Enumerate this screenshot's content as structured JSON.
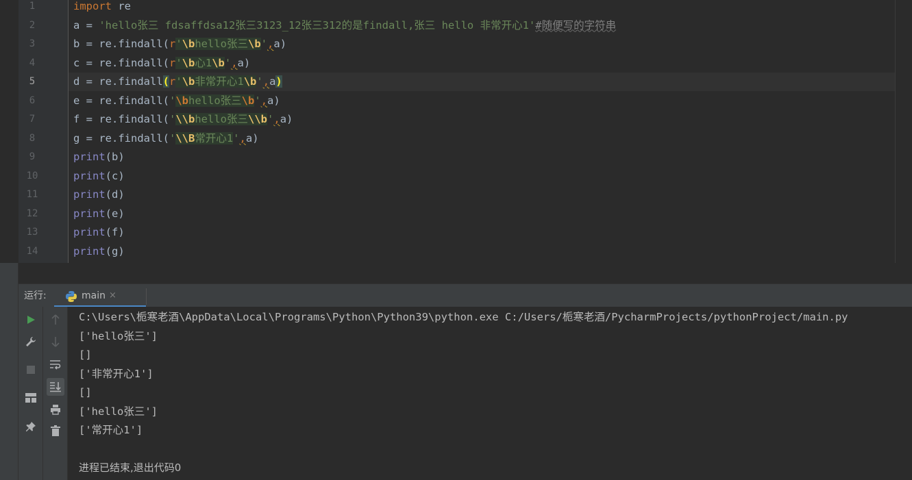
{
  "editor": {
    "line_numbers": [
      "1",
      "2",
      "3",
      "4",
      "5",
      "6",
      "7",
      "8",
      "9",
      "10",
      "11",
      "12",
      "13",
      "14"
    ],
    "current_line": "5",
    "lines": {
      "l1": {
        "kw": "import",
        "rest": " re"
      },
      "l2": {
        "lhs": "a = ",
        "str": "'hello张三 fdsaffdsa12张三3123_12张三312的是findall,张三 hello 非常开心1'",
        "comment": "#随便写的字符串"
      },
      "l3": {
        "lhs": "b = re.findall(",
        "r": "r",
        "q1": "'",
        "esc1": "\\b",
        "body": "hello张三",
        "esc2": "\\b",
        "q2": "'",
        "comma": ",",
        "arg": "a)"
      },
      "l4": {
        "lhs": "c = re.findall(",
        "r": "r",
        "q1": "'",
        "esc1": "\\b",
        "body": "心1",
        "esc2": "\\b",
        "q2": "'",
        "comma": ",",
        "arg": "a)"
      },
      "l5": {
        "lhs": "d = re.findall",
        "open": "(",
        "r": "r",
        "q1": "'",
        "esc1": "\\b",
        "body": "非常开心1",
        "esc2": "\\b",
        "q2": "'",
        "comma": ",",
        "arg": "a",
        "close": ")"
      },
      "l6": {
        "lhs": "e = re.findall(",
        "q1": "'",
        "esc1": "\\b",
        "body": "hello张三",
        "esc2": "\\b",
        "q2": "'",
        "comma": ",",
        "arg": "a)"
      },
      "l7": {
        "lhs": "f = re.findall(",
        "q1": "'",
        "esc1": "\\\\b",
        "body": "hello张三",
        "esc2": "\\\\b",
        "q2": "'",
        "comma": ",",
        "arg": "a)"
      },
      "l8": {
        "lhs": "g = re.findall(",
        "q1": "'",
        "esc1": "\\\\B",
        "body": "常开心1",
        "q2": "'",
        "comma": ",",
        "arg": "a)"
      },
      "l9": {
        "fn": "print",
        "arg": "(b)"
      },
      "l10": {
        "fn": "print",
        "arg": "(c)"
      },
      "l11": {
        "fn": "print",
        "arg": "(d)"
      },
      "l12": {
        "fn": "print",
        "arg": "(e)"
      },
      "l13": {
        "fn": "print",
        "arg": "(f)"
      },
      "l14": {
        "fn": "print",
        "arg": "(g)"
      }
    }
  },
  "run": {
    "label": "运行:",
    "tab_label": "main",
    "tab_close": "×",
    "output": [
      "C:\\Users\\栀寒老酒\\AppData\\Local\\Programs\\Python\\Python39\\python.exe C:/Users/栀寒老酒/PycharmProjects/pythonProject/main.py",
      "['hello张三']",
      "[]",
      "['非常开心1']",
      "[]",
      "['hello张三']",
      "['常开心1']",
      "",
      "进程已结束,退出代码0"
    ]
  },
  "icons": {
    "folder": "folder-icon",
    "python": "python-icon",
    "run": "run-icon",
    "wrench": "wrench-icon",
    "stop": "stop-icon",
    "layout": "layout-icon",
    "pin": "pin-icon",
    "up": "arrow-up-icon",
    "down": "arrow-down-icon",
    "wrap": "soft-wrap-icon",
    "scroll_end": "scroll-to-end-icon",
    "print": "print-icon",
    "trash": "trash-icon"
  },
  "colors": {
    "keyword": "#cc7832",
    "string": "#6a8759",
    "text": "#a9b7c6",
    "builtin": "#8888c6",
    "accent": "#4a88c7",
    "run_green": "#499c54"
  }
}
